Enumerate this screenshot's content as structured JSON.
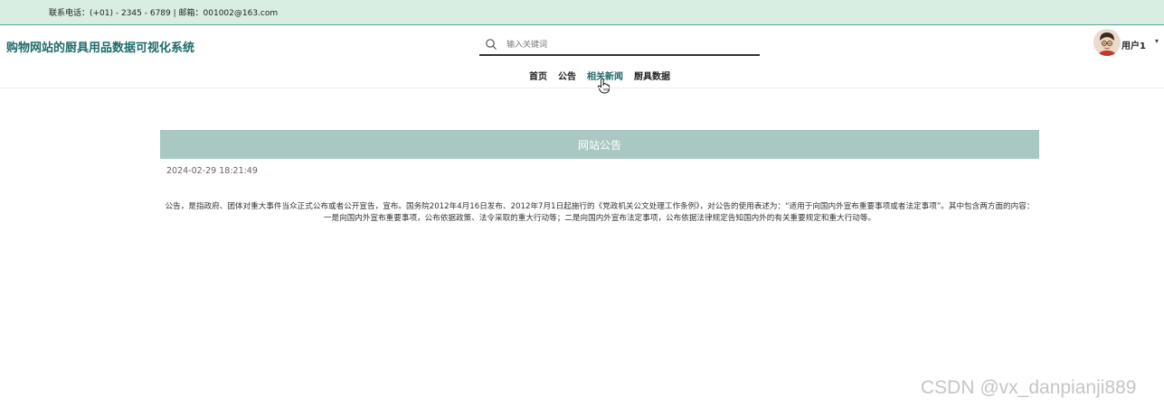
{
  "topbar": {
    "contact": "联系电话：(+01) - 2345 - 6789 | 邮箱：001002@163.com"
  },
  "header": {
    "site_title": "购物网站的厨具用品数据可视化系统",
    "search": {
      "placeholder": "输入关键词",
      "value": ""
    },
    "user": {
      "name": "用户1",
      "caret": "▾"
    }
  },
  "nav": {
    "items": [
      "首页",
      "公告",
      "相关新闻",
      "厨具数据"
    ],
    "active": "相关新闻"
  },
  "notice": {
    "heading": "网站公告",
    "date": "2024-02-29 18:21:49",
    "body": "公告，是指政府、团体对重大事件当众正式公布或者公开宣告，宣布。国务院2012年4月16日发布、2012年7月1日起施行的《党政机关公文处理工作条例》，对公告的使用表述为：“适用于向国内外宣布重要事项或者法定事项”。其中包含两方面的内容：一是向国内外宣布重要事项，公布依据政策、法令采取的重大行动等；二是向国内外宣布法定事项，公布依据法律规定告知国内外的有关重要规定和重大行动等。"
  },
  "watermark": "CSDN @vx_danpianji889",
  "colors": {
    "topbar_bg": "#d8eee2",
    "accent": "#1e6b6a",
    "card_head_bg": "#aac8c3"
  }
}
